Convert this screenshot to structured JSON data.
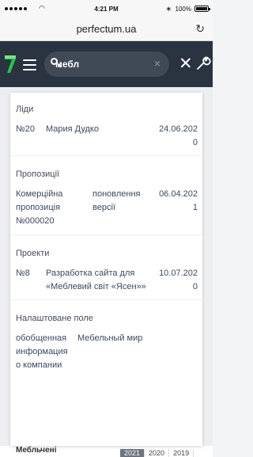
{
  "status_bar": {
    "time": "4:21 PM",
    "battery": "100%"
  },
  "browser": {
    "url": "perfectum.ua"
  },
  "header": {
    "search_value": "мебл"
  },
  "results": {
    "leads": {
      "title": "Ліди",
      "items": [
        {
          "number": "№20",
          "name": "Мария Дудко",
          "date_line1": "24.06.202",
          "date_line2": "0"
        }
      ]
    },
    "proposals": {
      "title": "Пропозиції",
      "items": [
        {
          "name_line1": "Комерційна",
          "name_line2": "пропозиція",
          "name_line3": "№000020",
          "desc_line1": "поновлення",
          "desc_line2": "версії",
          "date_line1": "06.04.202",
          "date_line2": "1"
        }
      ]
    },
    "projects": {
      "title": "Проекти",
      "items": [
        {
          "number": "№8",
          "name_line1": "Разработка сайта для",
          "name_line2": "«Меблевий світ «Ясен»»",
          "date_line1": "10.07.202",
          "date_line2": "0"
        }
      ]
    },
    "custom_field": {
      "title": "Налаштоване поле",
      "items": [
        {
          "label_line1": "обобщенная",
          "label_line2": "информация",
          "label_line3": "о компании",
          "value": "Мебельный мир"
        }
      ]
    }
  },
  "background_page": {
    "title": "Мебльчені",
    "years": [
      "2021",
      "2020",
      "2019"
    ]
  }
}
